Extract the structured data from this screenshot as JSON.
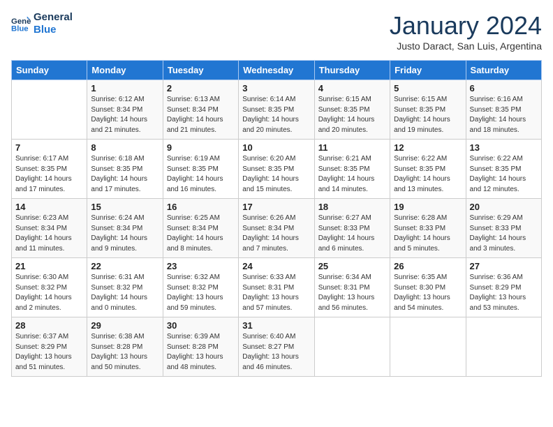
{
  "logo": {
    "line1": "General",
    "line2": "Blue"
  },
  "title": "January 2024",
  "subtitle": "Justo Daract, San Luis, Argentina",
  "headers": [
    "Sunday",
    "Monday",
    "Tuesday",
    "Wednesday",
    "Thursday",
    "Friday",
    "Saturday"
  ],
  "weeks": [
    [
      {
        "day": "",
        "info": ""
      },
      {
        "day": "1",
        "info": "Sunrise: 6:12 AM\nSunset: 8:34 PM\nDaylight: 14 hours\nand 21 minutes."
      },
      {
        "day": "2",
        "info": "Sunrise: 6:13 AM\nSunset: 8:34 PM\nDaylight: 14 hours\nand 21 minutes."
      },
      {
        "day": "3",
        "info": "Sunrise: 6:14 AM\nSunset: 8:35 PM\nDaylight: 14 hours\nand 20 minutes."
      },
      {
        "day": "4",
        "info": "Sunrise: 6:15 AM\nSunset: 8:35 PM\nDaylight: 14 hours\nand 20 minutes."
      },
      {
        "day": "5",
        "info": "Sunrise: 6:15 AM\nSunset: 8:35 PM\nDaylight: 14 hours\nand 19 minutes."
      },
      {
        "day": "6",
        "info": "Sunrise: 6:16 AM\nSunset: 8:35 PM\nDaylight: 14 hours\nand 18 minutes."
      }
    ],
    [
      {
        "day": "7",
        "info": "Sunrise: 6:17 AM\nSunset: 8:35 PM\nDaylight: 14 hours\nand 17 minutes."
      },
      {
        "day": "8",
        "info": "Sunrise: 6:18 AM\nSunset: 8:35 PM\nDaylight: 14 hours\nand 17 minutes."
      },
      {
        "day": "9",
        "info": "Sunrise: 6:19 AM\nSunset: 8:35 PM\nDaylight: 14 hours\nand 16 minutes."
      },
      {
        "day": "10",
        "info": "Sunrise: 6:20 AM\nSunset: 8:35 PM\nDaylight: 14 hours\nand 15 minutes."
      },
      {
        "day": "11",
        "info": "Sunrise: 6:21 AM\nSunset: 8:35 PM\nDaylight: 14 hours\nand 14 minutes."
      },
      {
        "day": "12",
        "info": "Sunrise: 6:22 AM\nSunset: 8:35 PM\nDaylight: 14 hours\nand 13 minutes."
      },
      {
        "day": "13",
        "info": "Sunrise: 6:22 AM\nSunset: 8:35 PM\nDaylight: 14 hours\nand 12 minutes."
      }
    ],
    [
      {
        "day": "14",
        "info": "Sunrise: 6:23 AM\nSunset: 8:34 PM\nDaylight: 14 hours\nand 11 minutes."
      },
      {
        "day": "15",
        "info": "Sunrise: 6:24 AM\nSunset: 8:34 PM\nDaylight: 14 hours\nand 9 minutes."
      },
      {
        "day": "16",
        "info": "Sunrise: 6:25 AM\nSunset: 8:34 PM\nDaylight: 14 hours\nand 8 minutes."
      },
      {
        "day": "17",
        "info": "Sunrise: 6:26 AM\nSunset: 8:34 PM\nDaylight: 14 hours\nand 7 minutes."
      },
      {
        "day": "18",
        "info": "Sunrise: 6:27 AM\nSunset: 8:33 PM\nDaylight: 14 hours\nand 6 minutes."
      },
      {
        "day": "19",
        "info": "Sunrise: 6:28 AM\nSunset: 8:33 PM\nDaylight: 14 hours\nand 5 minutes."
      },
      {
        "day": "20",
        "info": "Sunrise: 6:29 AM\nSunset: 8:33 PM\nDaylight: 14 hours\nand 3 minutes."
      }
    ],
    [
      {
        "day": "21",
        "info": "Sunrise: 6:30 AM\nSunset: 8:32 PM\nDaylight: 14 hours\nand 2 minutes."
      },
      {
        "day": "22",
        "info": "Sunrise: 6:31 AM\nSunset: 8:32 PM\nDaylight: 14 hours\nand 0 minutes."
      },
      {
        "day": "23",
        "info": "Sunrise: 6:32 AM\nSunset: 8:32 PM\nDaylight: 13 hours\nand 59 minutes."
      },
      {
        "day": "24",
        "info": "Sunrise: 6:33 AM\nSunset: 8:31 PM\nDaylight: 13 hours\nand 57 minutes."
      },
      {
        "day": "25",
        "info": "Sunrise: 6:34 AM\nSunset: 8:31 PM\nDaylight: 13 hours\nand 56 minutes."
      },
      {
        "day": "26",
        "info": "Sunrise: 6:35 AM\nSunset: 8:30 PM\nDaylight: 13 hours\nand 54 minutes."
      },
      {
        "day": "27",
        "info": "Sunrise: 6:36 AM\nSunset: 8:29 PM\nDaylight: 13 hours\nand 53 minutes."
      }
    ],
    [
      {
        "day": "28",
        "info": "Sunrise: 6:37 AM\nSunset: 8:29 PM\nDaylight: 13 hours\nand 51 minutes."
      },
      {
        "day": "29",
        "info": "Sunrise: 6:38 AM\nSunset: 8:28 PM\nDaylight: 13 hours\nand 50 minutes."
      },
      {
        "day": "30",
        "info": "Sunrise: 6:39 AM\nSunset: 8:28 PM\nDaylight: 13 hours\nand 48 minutes."
      },
      {
        "day": "31",
        "info": "Sunrise: 6:40 AM\nSunset: 8:27 PM\nDaylight: 13 hours\nand 46 minutes."
      },
      {
        "day": "",
        "info": ""
      },
      {
        "day": "",
        "info": ""
      },
      {
        "day": "",
        "info": ""
      }
    ]
  ]
}
